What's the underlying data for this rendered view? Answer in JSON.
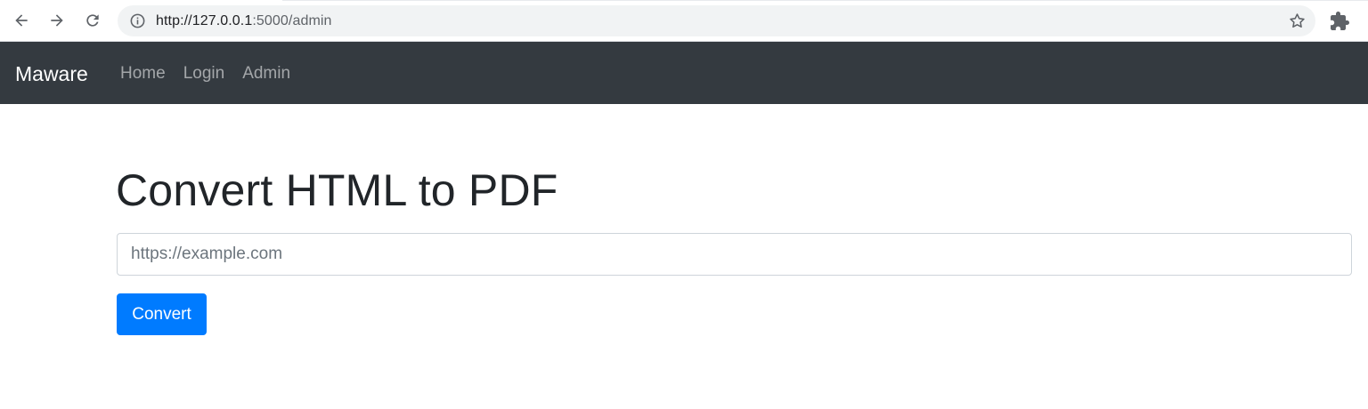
{
  "browser": {
    "url_host": "http://127.0.0.1",
    "url_rest": ":5000/admin"
  },
  "navbar": {
    "brand": "Maware",
    "links": [
      "Home",
      "Login",
      "Admin"
    ],
    "background": "#343a40"
  },
  "main": {
    "title": "Convert HTML to PDF",
    "input_placeholder": "https://example.com",
    "input_value": "",
    "button_label": "Convert",
    "button_color": "#007bff"
  },
  "icons": {
    "back": "arrow-left-icon",
    "forward": "arrow-right-icon",
    "reload": "reload-icon",
    "site_info": "info-icon",
    "bookmark": "star-icon",
    "extensions": "puzzle-icon"
  }
}
